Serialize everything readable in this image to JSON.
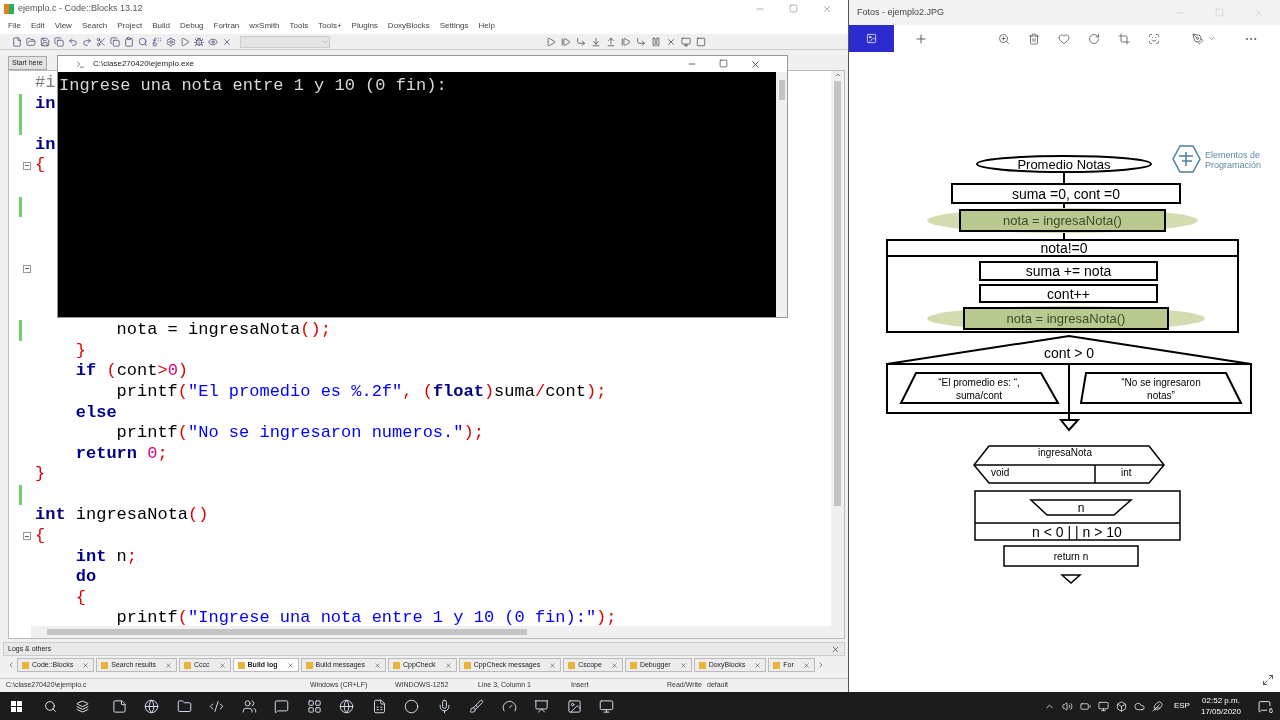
{
  "codeblocks": {
    "title": "ejemplo.c - Code::Blocks 13.12",
    "menu": [
      "File",
      "Edit",
      "View",
      "Search",
      "Project",
      "Build",
      "Debug",
      "Fortran",
      "wxSmith",
      "Tools",
      "Tools+",
      "Plugins",
      "DoxyBlocks",
      "Settings",
      "Help"
    ],
    "editor_tabs": [
      {
        "label": "Start here",
        "selected": false
      }
    ],
    "lines": [
      {
        "fold": false,
        "changed": false,
        "tokens": [
          {
            "kind": "pre",
            "text": "#i"
          }
        ]
      },
      {
        "fold": false,
        "changed": true,
        "tokens": [
          {
            "kind": "kw",
            "text": "in"
          }
        ]
      },
      {
        "fold": false,
        "changed": true
      },
      {
        "fold": false,
        "changed": false,
        "tokens": [
          {
            "kind": "kw",
            "text": "in"
          }
        ]
      },
      {
        "fold": true,
        "changed": false,
        "tokens": [
          {
            "kind": "op",
            "text": "{"
          }
        ]
      },
      {
        "fold": false,
        "changed": false
      },
      {
        "fold": false,
        "changed": true
      },
      {
        "fold": false,
        "changed": false
      },
      {
        "fold": false,
        "changed": false
      },
      {
        "fold": true,
        "changed": false
      },
      {
        "fold": false,
        "changed": false
      },
      {
        "fold": false,
        "changed": false
      },
      {
        "fold": false,
        "changed": true,
        "tokens": [
          {
            "kind": "plain",
            "text": "        nota = ingresaNota"
          },
          {
            "kind": "op",
            "text": "();"
          }
        ]
      },
      {
        "fold": false,
        "changed": false,
        "tokens": [
          {
            "kind": "op",
            "text": "    }"
          }
        ]
      },
      {
        "fold": false,
        "changed": false,
        "tokens": [
          {
            "kind": "kw",
            "text": "    if"
          },
          {
            "kind": "op",
            "text": " ("
          },
          {
            "kind": "plain",
            "text": "cont"
          },
          {
            "kind": "op",
            "text": ">"
          },
          {
            "kind": "num",
            "text": "0"
          },
          {
            "kind": "op",
            "text": ")"
          }
        ]
      },
      {
        "fold": false,
        "changed": false,
        "tokens": [
          {
            "kind": "plain",
            "text": "        printf"
          },
          {
            "kind": "op",
            "text": "("
          },
          {
            "kind": "str",
            "text": "\"El promedio es %.2f\""
          },
          {
            "kind": "op",
            "text": ", ("
          },
          {
            "kind": "kw",
            "text": "float"
          },
          {
            "kind": "op",
            "text": ")"
          },
          {
            "kind": "plain",
            "text": "suma"
          },
          {
            "kind": "op",
            "text": "/"
          },
          {
            "kind": "plain",
            "text": "cont"
          },
          {
            "kind": "op",
            "text": ");"
          }
        ]
      },
      {
        "fold": false,
        "changed": false,
        "tokens": [
          {
            "kind": "kw",
            "text": "    else"
          }
        ]
      },
      {
        "fold": false,
        "changed": false,
        "tokens": [
          {
            "kind": "plain",
            "text": "        printf"
          },
          {
            "kind": "op",
            "text": "("
          },
          {
            "kind": "str",
            "text": "\"No se ingresaron numeros.\""
          },
          {
            "kind": "op",
            "text": ");"
          }
        ]
      },
      {
        "fold": false,
        "changed": false,
        "tokens": [
          {
            "kind": "kw",
            "text": "    return"
          },
          {
            "kind": "num",
            "text": " 0"
          },
          {
            "kind": "op",
            "text": ";"
          }
        ]
      },
      {
        "fold": false,
        "changed": false,
        "tokens": [
          {
            "kind": "op",
            "text": "}"
          }
        ]
      },
      {
        "fold": false,
        "changed": true
      },
      {
        "fold": false,
        "changed": false,
        "tokens": [
          {
            "kind": "kw",
            "text": "int"
          },
          {
            "kind": "plain",
            "text": " ingresaNota"
          },
          {
            "kind": "op",
            "text": "()"
          }
        ]
      },
      {
        "fold": true,
        "changed": false,
        "tokens": [
          {
            "kind": "op",
            "text": "{"
          }
        ]
      },
      {
        "fold": false,
        "changed": false,
        "tokens": [
          {
            "kind": "kw",
            "text": "    int"
          },
          {
            "kind": "plain",
            "text": " n"
          },
          {
            "kind": "op",
            "text": ";"
          }
        ]
      },
      {
        "fold": false,
        "changed": false,
        "tokens": [
          {
            "kind": "kw",
            "text": "    do"
          }
        ]
      },
      {
        "fold": false,
        "changed": false,
        "tokens": [
          {
            "kind": "op",
            "text": "    {"
          }
        ]
      },
      {
        "fold": false,
        "changed": false,
        "tokens": [
          {
            "kind": "plain",
            "text": "        printf"
          },
          {
            "kind": "op",
            "text": "("
          },
          {
            "kind": "str",
            "text": "\"Ingrese una nota entre 1 y 10 (0 fin):\""
          },
          {
            "kind": "op",
            "text": ");"
          }
        ]
      }
    ],
    "logs": {
      "title": "Logs & others",
      "tabs": [
        {
          "label": "Code::Blocks",
          "selected": false
        },
        {
          "label": "Search results",
          "selected": false
        },
        {
          "label": "Cccc",
          "selected": false
        },
        {
          "label": "Build log",
          "selected": true
        },
        {
          "label": "Build messages",
          "selected": false
        },
        {
          "label": "CppCheck",
          "selected": false
        },
        {
          "label": "CppCheck messages",
          "selected": false
        },
        {
          "label": "Cscope",
          "selected": false
        },
        {
          "label": "Debugger",
          "selected": false
        },
        {
          "label": "DoxyBlocks",
          "selected": false
        },
        {
          "label": "For",
          "selected": false
        }
      ]
    },
    "status_bar": [
      "C:\\clase270420\\ejemplo.c",
      "Windows (CR+LF)",
      "WINDOWS-1252",
      "Line 3, Column 1",
      "Insert",
      "Read/Write",
      "default"
    ]
  },
  "console": {
    "title": "C:\\clase270420\\ejemplo.exe",
    "output": "Ingrese una nota entre 1 y 10 (0 fin):"
  },
  "photos": {
    "title": "Fotos - ejemplo2.JPG",
    "diagram": {
      "logo": [
        "Elementos de",
        "Programación"
      ],
      "start": "Promedio Notas",
      "init": {
        "text": "suma =0, cont =0",
        "highlighted": false
      },
      "read": {
        "text": "nota = ingresaNota()",
        "highlighted": true
      },
      "loop": {
        "condition": "nota!=0",
        "body": [
          {
            "text": "suma += nota",
            "highlighted": false
          },
          {
            "text": "cont++",
            "highlighted": false
          },
          {
            "text": "nota = ingresaNota()",
            "highlighted": true
          }
        ]
      },
      "decision": {
        "condition": "cont > 0",
        "then": [
          "“El promedio es: “,",
          "suma/cont"
        ],
        "else": [
          "“No se ingresaron",
          "notas”"
        ]
      },
      "function": {
        "name": "ingresaNota",
        "params": "void",
        "returns": "int",
        "input": "n",
        "condition": "n < 0 | | n > 10",
        "return": "return n"
      }
    }
  },
  "taskbar": {
    "language": "ESP",
    "time": "02:52 p.m.",
    "date": "17/05/2020",
    "notifications": "6"
  }
}
